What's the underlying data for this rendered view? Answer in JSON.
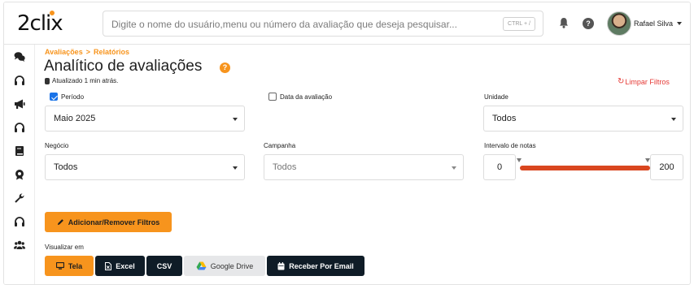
{
  "brand": {
    "logo_text": "2clix",
    "accent": "#f7941d",
    "danger": "#e53935",
    "slider_color": "#d9461f",
    "dark_button": "#0f1c27"
  },
  "search": {
    "placeholder": "Digite o nome do usuário,menu ou número da avaliação que deseja pesquisar...",
    "shortcut": "CTRL + /"
  },
  "header": {
    "user_name": "Rafael Silva",
    "icons": [
      "bell-icon",
      "help-icon",
      "avatar"
    ]
  },
  "sidebar": {
    "items": [
      "chat-icon",
      "headset-icon",
      "megaphone-icon",
      "headset-icon",
      "book-icon",
      "badge-icon",
      "wrench-icon",
      "headset-icon",
      "users-icon"
    ]
  },
  "breadcrumb": {
    "level1": "Avaliações",
    "separator": ">",
    "level2": "Relatórios"
  },
  "page": {
    "title": "Analítico de avaliações",
    "help_badge": "?",
    "updated": "Atualizado 1 min atrás.",
    "clear_filters": "Limpar Filtros"
  },
  "filters": {
    "periodo": {
      "label": "Período",
      "checked": true,
      "value": "Maio 2025"
    },
    "data_avaliacao": {
      "label": "Data da avaliação",
      "checked": false
    },
    "unidade": {
      "label": "Unidade",
      "value": "Todos"
    },
    "negocio": {
      "label": "Negócio",
      "value": "Todos"
    },
    "campanha": {
      "label": "Campanha",
      "value": "Todos",
      "disabled": true
    },
    "intervalo": {
      "label": "Intervalo de notas",
      "min": "0",
      "max": "200"
    }
  },
  "actions": {
    "add_remove_filters": "Adicionar/Remover Filtros"
  },
  "view": {
    "label": "Visualizar em",
    "buttons": {
      "tela": "Tela",
      "excel": "Excel",
      "csv": "CSV",
      "drive": "Google Drive",
      "email": "Receber Por Email"
    }
  }
}
